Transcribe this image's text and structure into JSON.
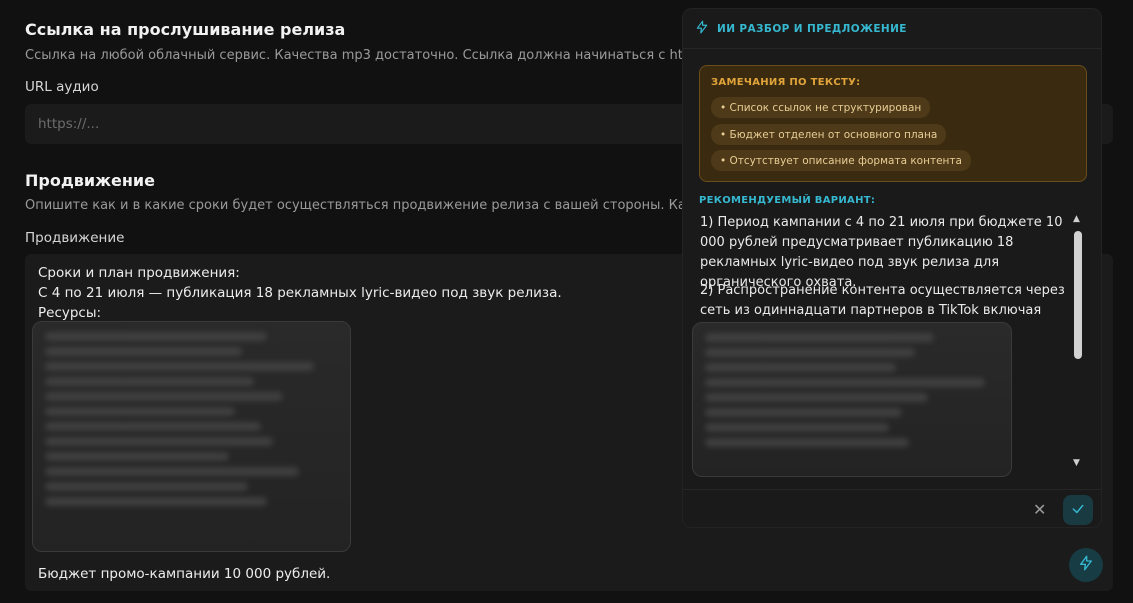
{
  "release_link": {
    "title": "Ссылка на прослушивание релиза",
    "description": "Ссылка на любой облачный сервис. Качества mp3 достаточно. Ссылка должна начинаться с https://",
    "field_label": "URL аудио",
    "placeholder": "https://..."
  },
  "promotion": {
    "title": "Продвижение",
    "description": "Опишите как и в какие сроки будет осуществляться продвижение релиза с вашей стороны. Какие ресурсы будут задействованы",
    "field_label": "Продвижение",
    "text_lines": [
      "Сроки и план продвижения:",
      "С 4 по 21 июля — публикация 18 рекламных lyric-видео под звук релиза.",
      "Ресурсы:"
    ],
    "budget_line": "Бюджет промо-кампании 10 000 рублей."
  },
  "ai_panel": {
    "title": "ИИ РАЗБОР И ПРЕДЛОЖЕНИЕ",
    "issues_title": "ЗАМЕЧАНИЯ ПО ТЕКСТУ:",
    "issues": [
      "• Список ссылок не структурирован",
      "• Бюджет отделен от основного плана",
      "• Отсутствует описание формата контента"
    ],
    "recommended_title": "РЕКОМЕНДУЕМЫЙ ВАРИАНТ:",
    "recommended": [
      "1) Период кампании с 4 по 21 июля при бюджете 10 000 рублей предусматривает публикацию 18 рекламных lyric-видео под звук релиза для органического охвата.",
      "2) Распространение контента осуществляется через сеть из одиннадцати партнеров в TikTok включая профили"
    ]
  },
  "icons": {
    "panel_icon": "lightning-icon",
    "close": "close-icon",
    "accept": "check-icon",
    "fab": "lightning-icon",
    "scroll_up": "triangle-up-icon",
    "scroll_down": "triangle-down-icon"
  },
  "colors": {
    "accent": "#35b8d0",
    "warning_bg": "#3a2a10",
    "warning_text": "#e0a43a"
  }
}
